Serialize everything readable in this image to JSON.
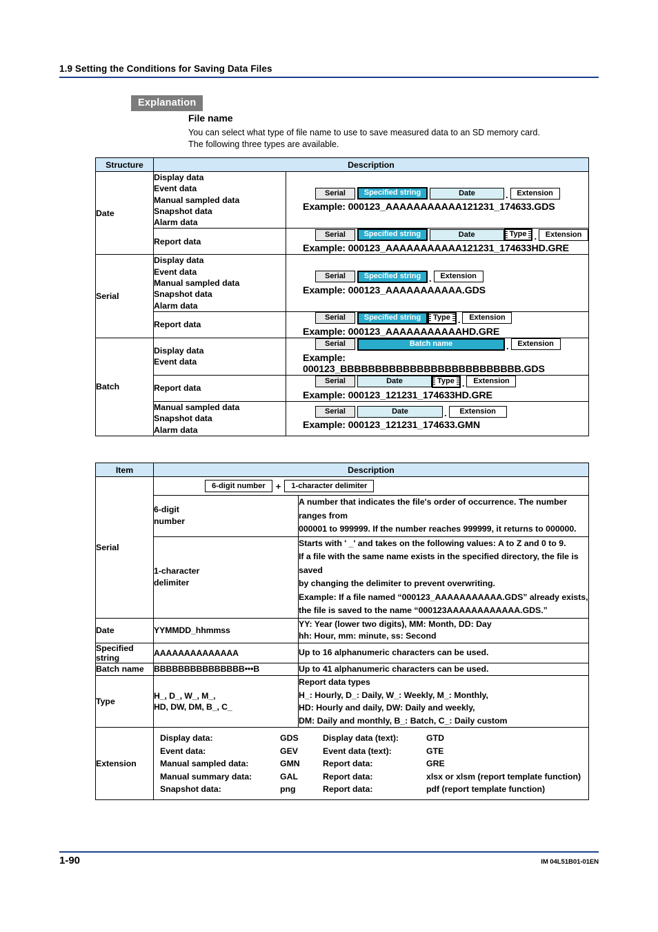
{
  "header": {
    "running_head": "1.9  Setting the Conditions for Saving Data Files"
  },
  "explanation": {
    "badge": "Explanation",
    "section_title": "File name",
    "intro_line1": "You can select what type of file name to use to save measured data to an SD memory card.",
    "intro_line2": "The following three types are available."
  },
  "structure_table": {
    "headers": {
      "structure": "Structure",
      "description": "Description"
    },
    "segments": {
      "serial": "Serial",
      "specified_string": "Specified string",
      "date": "Date",
      "batch_name": "Batch name",
      "type": "Type",
      "extension": "Extension",
      "dot": "."
    },
    "rows": [
      {
        "structure": "Date",
        "data_types_line1": "Display data",
        "data_types_line2": "Event data",
        "data_types_line3": "Manual sampled data",
        "data_types_line4": "Snapshot data",
        "data_types_line5": "Alarm data",
        "example": "Example: 000123_AAAAAAAAAAA121231_174633.GDS"
      },
      {
        "structure": "",
        "data_types_line1": "Report data",
        "example": "Example: 000123_AAAAAAAAAAA121231_174633HD.GRE"
      },
      {
        "structure": "Serial",
        "data_types_line1": "Display data",
        "data_types_line2": "Event data",
        "data_types_line3": "Manual sampled data",
        "data_types_line4": "Snapshot data",
        "data_types_line5": "Alarm data",
        "example": "Example: 000123_AAAAAAAAAAA.GDS"
      },
      {
        "structure": "",
        "data_types_line1": "Report data",
        "example": "Example: 000123_AAAAAAAAAAAHD.GRE"
      },
      {
        "structure": "Batch",
        "data_types_line1": "Display data",
        "data_types_line2": "Event data",
        "example": "Example: 000123_BBBBBBBBBBBBBBBBBBBBBBBBBB.GDS"
      },
      {
        "structure": "",
        "data_types_line1": "Report data",
        "example": "Example: 000123_121231_174633HD.GRE"
      },
      {
        "structure": "",
        "data_types_line1": "Manual sampled data",
        "data_types_line2": "Snapshot data",
        "data_types_line3": "Alarm data",
        "example": "Example: 000123_121231_174633.GMN"
      }
    ]
  },
  "item_table": {
    "headers": {
      "item": "Item",
      "description": "Description"
    },
    "serial": {
      "label": "Serial",
      "composition": {
        "part1": "6-digit number",
        "operator": "+",
        "part2": "1-character delimiter"
      },
      "sub_rows": [
        {
          "label_line1": "6-digit",
          "label_line2": "number",
          "desc_line1": "A number that indicates the file's order of occurrence. The number ranges from",
          "desc_line2": "000001 to 999999. If the number reaches 999999, it returns to 000000."
        },
        {
          "label_line1": "1-character",
          "label_line2": "delimiter",
          "desc_line1": "Starts with ' _' and takes on the following values: A to Z and 0 to 9.",
          "desc_line2": "If a file with the same name exists in the specified directory, the file is saved",
          "desc_line3": "by changing the delimiter to prevent overwriting.",
          "desc_line4": "Example: If a file named “000123_AAAAAAAAAAA.GDS” already exists,",
          "desc_line5": "the file is saved to the name “000123AAAAAAAAAAAA.GDS.”"
        }
      ]
    },
    "date": {
      "label": "Date",
      "value": "YYMMDD_hhmmss",
      "desc_line1": "YY: Year (lower two digits), MM: Month, DD: Day",
      "desc_line2": "hh: Hour, mm: minute, ss: Second"
    },
    "specified_string": {
      "label_line1": "Specified",
      "label_line2": "string",
      "value": "AAAAAAAAAAAAAA",
      "desc": "Up to 16 alphanumeric characters can be used."
    },
    "batch_name": {
      "label": "Batch name",
      "value": "BBBBBBBBBBBBBBB•••B",
      "desc": "Up to 41 alphanumeric characters can be used."
    },
    "type": {
      "label": "Type",
      "value_line1": "H_, D_, W_, M_,",
      "value_line2": "HD, DW, DM, B_, C_",
      "desc_line1": "Report data types",
      "desc_line2": "H_: Hourly, D_: Daily, W_: Weekly, M_: Monthly,",
      "desc_line3": "HD: Hourly and daily, DW: Daily and weekly,",
      "desc_line4": "DM: Daily and monthly, B_: Batch, C_: Daily custom"
    },
    "extension": {
      "label": "Extension",
      "entries": [
        {
          "left_label": "Display data:",
          "left_value": "GDS",
          "right_label": "Display data (text):",
          "right_value": "GTD"
        },
        {
          "left_label": "Event data:",
          "left_value": "GEV",
          "right_label": "Event data (text):",
          "right_value": "GTE"
        },
        {
          "left_label": "Manual sampled data:",
          "left_value": "GMN",
          "right_label": "Report data:",
          "right_value": "GRE"
        },
        {
          "left_label": "Manual summary data:",
          "left_value": "GAL",
          "right_label": "Report data:",
          "right_value": "xlsx or xlsm (report template function)"
        },
        {
          "left_label": "Snapshot data:",
          "left_value": "png",
          "right_label": "Report data:",
          "right_value": "pdf (report template function)"
        }
      ]
    }
  },
  "footer": {
    "page_number": "1-90",
    "document_code": "IM 04L51B01-01EN"
  },
  "colors": {
    "rule": "#1b3f8f",
    "table_header": "#cfe7f7",
    "accent_cyan": "#29abcc",
    "light_cyan": "#d7eff4",
    "segment_gray": "#e8e8e8",
    "badge_gray": "#7c7c7c"
  }
}
